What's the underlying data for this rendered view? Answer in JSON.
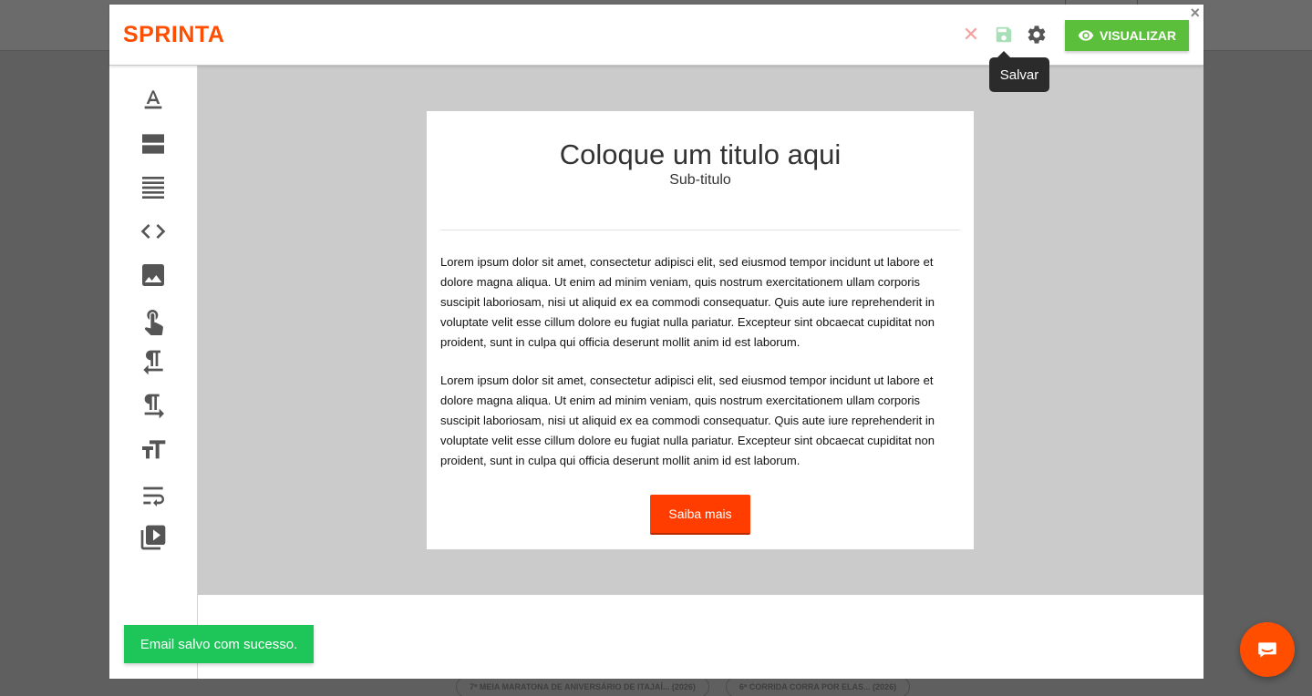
{
  "app": {
    "logo_text": "SPRINTA",
    "brand_color": "#ff4e00"
  },
  "header": {
    "visualizar_label": "VISUALIZAR",
    "save_tooltip": "Salvar",
    "icons": [
      "close-icon",
      "save-icon",
      "gear-icon",
      "eye-icon"
    ]
  },
  "sidebar": {
    "tools": [
      {
        "name": "text-color-tool",
        "icon": "text-format-icon"
      },
      {
        "name": "layout-tool",
        "icon": "layout-rows-icon"
      },
      {
        "name": "paragraph-tool",
        "icon": "align-lines-icon"
      },
      {
        "name": "html-code-tool",
        "icon": "code-icon"
      },
      {
        "name": "image-tool",
        "icon": "image-icon"
      },
      {
        "name": "button-tool",
        "icon": "touch-icon"
      },
      {
        "name": "rtl-paragraph-tool",
        "icon": "pilcrow-left-icon"
      },
      {
        "name": "ltr-paragraph-tool",
        "icon": "pilcrow-right-icon"
      },
      {
        "name": "title-tool",
        "icon": "text-size-icon"
      },
      {
        "name": "wrap-tool",
        "icon": "wrap-text-icon"
      },
      {
        "name": "video-tool",
        "icon": "video-library-icon"
      }
    ]
  },
  "email": {
    "title": "Coloque um titulo aqui",
    "subtitle": "Sub-titulo",
    "paragraph_1": "Lorem ipsum dolor sit amet, consectetur adipisci elit, sed eiusmod tempor incidunt ut labore et dolore magna aliqua. Ut enim ad minim veniam, quis nostrum exercitationem ullam corporis suscipit laboriosam, nisi ut aliquid ex ea commodi consequatur. Quis aute iure reprehenderit in voluptate velit esse cillum dolore eu fugiat nulla pariatur. Excepteur sint obcaecat cupiditat non proident, sunt in culpa qui officia deserunt mollit anim id est laborum.",
    "paragraph_2": "Lorem ipsum dolor sit amet, consectetur adipisci elit, sed eiusmod tempor incidunt ut labore et dolore magna aliqua. Ut enim ad minim veniam, quis nostrum exercitationem ullam corporis suscipit laboriosam, nisi ut aliquid ex ea commodi consequatur. Quis aute iure reprehenderit in voluptate velit esse cillum dolore eu fugiat nulla pariatur. Excepteur sint obcaecat cupiditat non proident, sunt in culpa qui officia deserunt mollit anim id est laborum.",
    "cta_label": "Saiba mais"
  },
  "toast": {
    "message": "Email salvo com sucesso."
  },
  "background": {
    "chips": [
      "7ª MEIA MARATONA DE ANIVERSÁRIO DE ITAJAÍ... (2026)",
      "6ª CORRIDA CORRA POR ELAS... (2026)"
    ]
  },
  "colors": {
    "visualizar_bg": "#5cbf3b",
    "toast_bg": "#1ec659",
    "cta_bg": "#ff3d00",
    "canvas_bg": "#cbcbcb"
  }
}
